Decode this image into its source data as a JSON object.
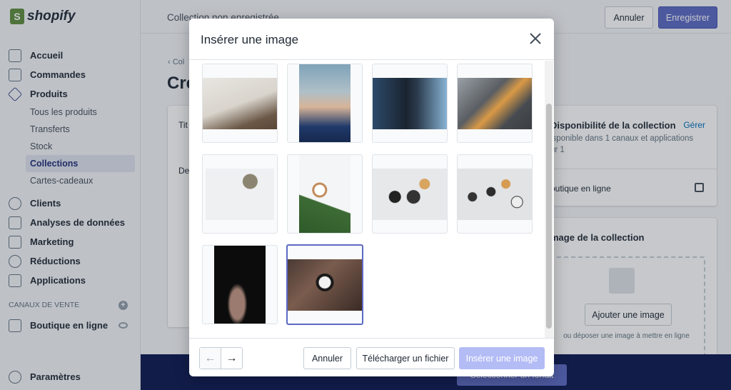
{
  "sidebar": {
    "brand": "shopify",
    "items": [
      {
        "label": "Accueil",
        "icon": "home-icon"
      },
      {
        "label": "Commandes",
        "icon": "orders-icon"
      },
      {
        "label": "Produits",
        "icon": "tag-icon"
      }
    ],
    "sub_items": [
      "Tous les produits",
      "Transferts",
      "Stock",
      "Collections",
      "Cartes-cadeaux"
    ],
    "active_sub": "Collections",
    "items2": [
      {
        "label": "Clients",
        "icon": "person-icon"
      },
      {
        "label": "Analyses de données",
        "icon": "chart-icon"
      },
      {
        "label": "Marketing",
        "icon": "megaphone-icon"
      },
      {
        "label": "Réductions",
        "icon": "discount-icon"
      },
      {
        "label": "Applications",
        "icon": "apps-icon"
      }
    ],
    "sales_channels_label": "CANAUX DE VENTE",
    "online_store": "Boutique en ligne",
    "settings": "Paramètres"
  },
  "topbar": {
    "title": "Collection non enregistrée",
    "cancel": "Annuler",
    "save": "Enregistrer"
  },
  "main": {
    "back": "Col",
    "title": "Cré",
    "title_label": "Tit",
    "desc_label": "De",
    "availability": {
      "title": "Disponibilité de la collection",
      "manage": "Gérer",
      "text": "isponible dans 1 canaux et applications",
      "text2": "ur 1",
      "channel": "outique en ligne"
    },
    "image_card": {
      "title": "mage de la collection",
      "add": "Ajouter une image",
      "drop": "ou déposer une image à mettre en ligne"
    }
  },
  "banner": {
    "button": "Sélectionner un forfait"
  },
  "modal": {
    "title": "Insérer une image",
    "cancel": "Annuler",
    "upload": "Télécharger un fichier",
    "insert": "Insérer une image",
    "selected_index": 9,
    "colors": {
      "accent": "#5c6ac4",
      "insert_disabled": "#b3bcf5"
    }
  }
}
